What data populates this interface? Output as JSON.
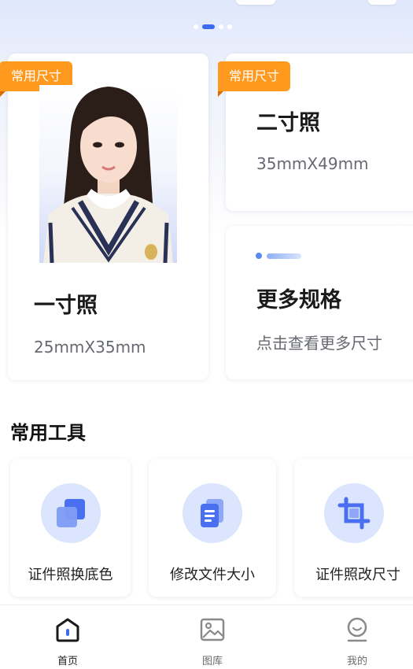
{
  "carousel": {
    "page_count": 4,
    "active_index": 1
  },
  "size_cards": {
    "one_inch": {
      "badge": "常用尺寸",
      "title": "一寸照",
      "dimensions": "25mmX35mm"
    },
    "two_inch": {
      "badge": "常用尺寸",
      "title": "二寸照",
      "dimensions": "35mmX49mm"
    },
    "more": {
      "title": "更多规格",
      "subtitle": "点击查看更多尺寸"
    }
  },
  "tools": {
    "section_title": "常用工具",
    "items": [
      {
        "label": "证件照换底色",
        "icon": "change-background-icon"
      },
      {
        "label": "修改文件大小",
        "icon": "file-size-icon"
      },
      {
        "label": "证件照改尺寸",
        "icon": "crop-icon"
      }
    ]
  },
  "tabbar": {
    "items": [
      {
        "label": "首页",
        "icon": "home-icon",
        "active": true
      },
      {
        "label": "图库",
        "icon": "gallery-icon",
        "active": false
      },
      {
        "label": "我的",
        "icon": "profile-icon",
        "active": false
      }
    ]
  },
  "colors": {
    "accent": "#3b6cf0",
    "badge": "#ff9a1f",
    "icon_bg": "#dbe5fd"
  }
}
